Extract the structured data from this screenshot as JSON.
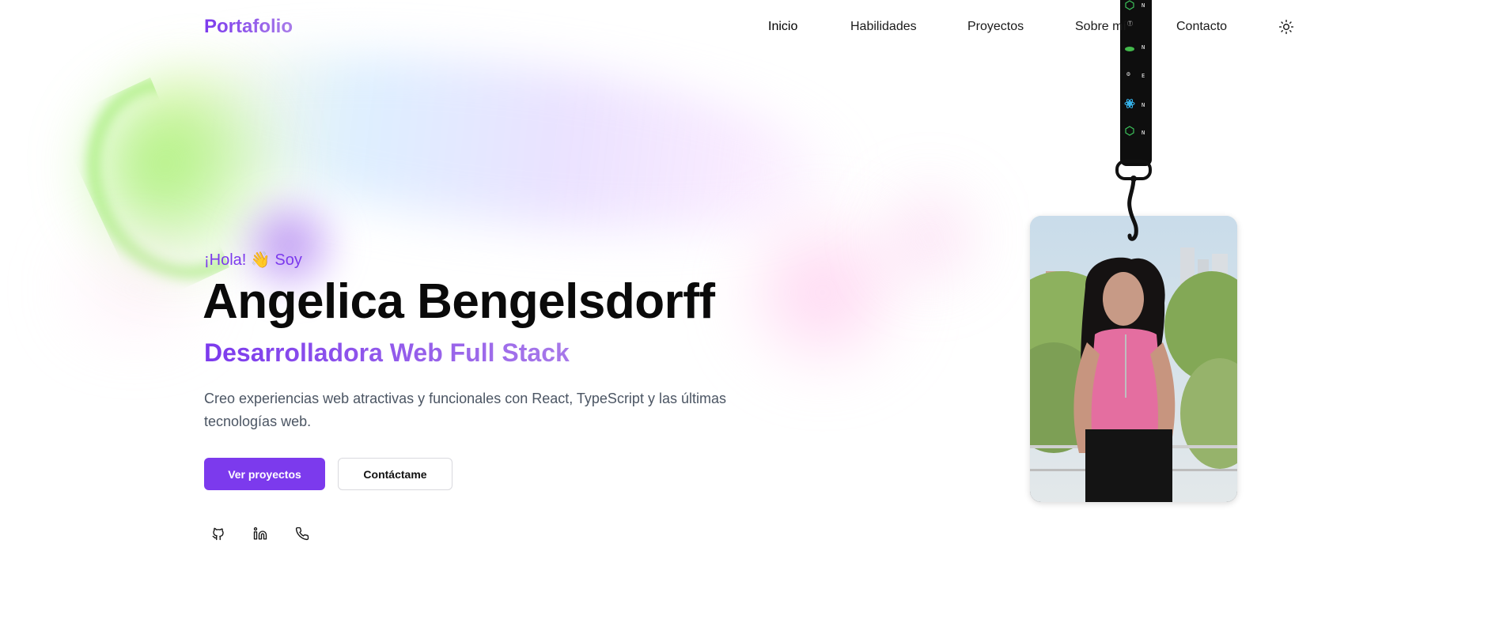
{
  "nav": {
    "logo": "Portafolio",
    "items": [
      {
        "label": "Inicio",
        "active": true
      },
      {
        "label": "Habilidades",
        "active": false
      },
      {
        "label": "Proyectos",
        "active": false
      },
      {
        "label": "Sobre mí",
        "active": false
      },
      {
        "label": "Contacto",
        "active": false
      }
    ],
    "theme_icon": "sun-icon"
  },
  "hero": {
    "greeting": "¡Hola! 👋 Soy",
    "name": "Angelica Bengelsdorff",
    "role": "Desarrolladora Web Full Stack",
    "intro": "Creo experiencias web atractivas y funcionales con React, TypeScript y las últimas tecnologías web.",
    "primary_button": "Ver proyectos",
    "secondary_button": "Contáctame",
    "social_icons": [
      "github-icon",
      "linkedin-icon",
      "phone-icon"
    ]
  },
  "badge": {
    "lanyard_icons": [
      "node-icon",
      "vue-icon",
      "react-icon"
    ],
    "photo_icon": "person-photo"
  },
  "colors": {
    "accent": "#7c3aed",
    "text": "#0a0a0a",
    "muted": "#4b5563"
  }
}
